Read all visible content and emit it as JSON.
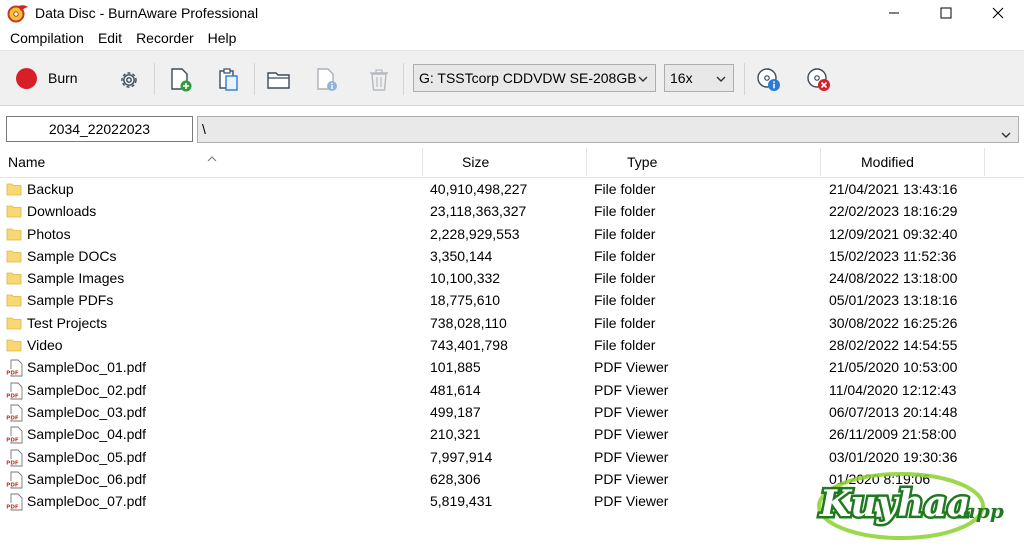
{
  "window": {
    "title": "Data Disc - BurnAware Professional",
    "controls": {
      "minimize": "—",
      "maximize": "☐",
      "close": "✕"
    }
  },
  "menu": [
    "Compilation",
    "Edit",
    "Recorder",
    "Help"
  ],
  "toolbar": {
    "burn_label": "Burn",
    "drive": "G: TSSTcorp CDDVDW SE-208GB",
    "speed": "16x",
    "accent": "#d71f2a"
  },
  "pathbar": {
    "disc_label": "2034_22022023",
    "path": "\\"
  },
  "columns": {
    "name": "Name",
    "size": "Size",
    "type": "Type",
    "modified": "Modified"
  },
  "files": [
    {
      "icon": "folder-icon",
      "name": "Backup",
      "size": "40,910,498,227",
      "type": "File folder",
      "modified": "21/04/2021 13:43:16"
    },
    {
      "icon": "folder-icon",
      "name": "Downloads",
      "size": "23,118,363,327",
      "type": "File folder",
      "modified": "22/02/2023 18:16:29"
    },
    {
      "icon": "folder-icon",
      "name": "Photos",
      "size": "2,228,929,553",
      "type": "File folder",
      "modified": "12/09/2021 09:32:40"
    },
    {
      "icon": "folder-icon",
      "name": "Sample DOCs",
      "size": "3,350,144",
      "type": "File folder",
      "modified": "15/02/2023 11:52:36"
    },
    {
      "icon": "folder-icon",
      "name": "Sample Images",
      "size": "10,100,332",
      "type": "File folder",
      "modified": "24/08/2022 13:18:00"
    },
    {
      "icon": "folder-icon",
      "name": "Sample PDFs",
      "size": "18,775,610",
      "type": "File folder",
      "modified": "05/01/2023 13:18:16"
    },
    {
      "icon": "folder-icon",
      "name": "Test Projects",
      "size": "738,028,110",
      "type": "File folder",
      "modified": "30/08/2022 16:25:26"
    },
    {
      "icon": "folder-icon",
      "name": "Video",
      "size": "743,401,798",
      "type": "File folder",
      "modified": "28/02/2022 14:54:55"
    },
    {
      "icon": "pdf-file-icon",
      "name": "SampleDoc_01.pdf",
      "size": "101,885",
      "type": "PDF Viewer",
      "modified": "21/05/2020 10:53:00"
    },
    {
      "icon": "pdf-file-icon",
      "name": "SampleDoc_02.pdf",
      "size": "481,614",
      "type": "PDF Viewer",
      "modified": "11/04/2020 12:12:43"
    },
    {
      "icon": "pdf-file-icon",
      "name": "SampleDoc_03.pdf",
      "size": "499,187",
      "type": "PDF Viewer",
      "modified": "06/07/2013 20:14:48"
    },
    {
      "icon": "pdf-file-icon",
      "name": "SampleDoc_04.pdf",
      "size": "210,321",
      "type": "PDF Viewer",
      "modified": "26/11/2009 21:58:00"
    },
    {
      "icon": "pdf-file-icon",
      "name": "SampleDoc_05.pdf",
      "size": "7,997,914",
      "type": "PDF Viewer",
      "modified": "03/01/2020 19:30:36"
    },
    {
      "icon": "pdf-file-icon",
      "name": "SampleDoc_06.pdf",
      "size": "628,306",
      "type": "PDF Viewer",
      "modified": "01/2020 8:19:06"
    },
    {
      "icon": "pdf-file-icon",
      "name": "SampleDoc_07.pdf",
      "size": "5,819,431",
      "type": "PDF Viewer",
      "modified": ""
    }
  ],
  "watermark": {
    "text": "Kuyhaa",
    "suffix": ".app",
    "colors": {
      "primary": "#1f7a1f",
      "accent": "#8bd12c"
    }
  }
}
